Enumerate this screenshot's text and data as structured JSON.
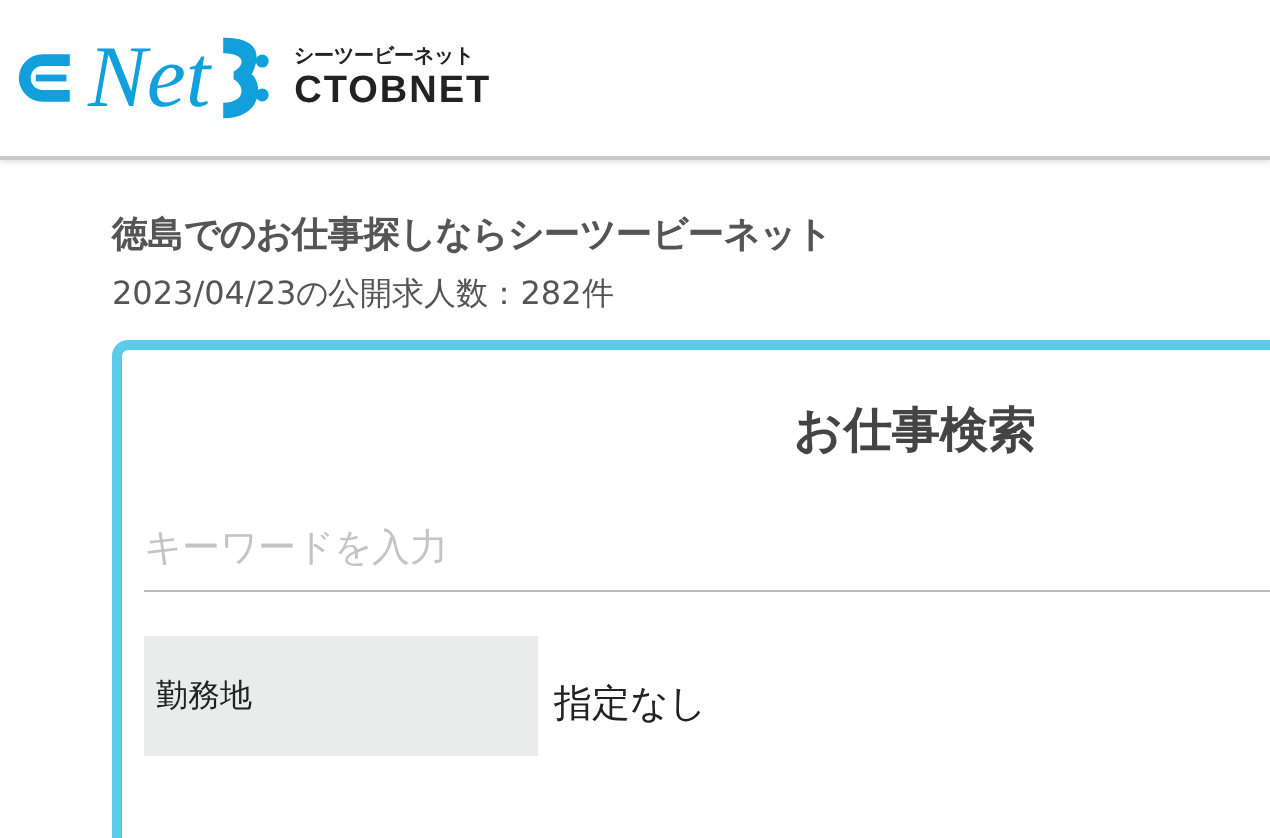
{
  "logo": {
    "wordmark": "Net",
    "kana": "シーツービーネット",
    "latin": "CTOBNET"
  },
  "intro": {
    "title": "徳島でのお仕事探しならシーツービーネット",
    "count": "2023/04/23の公開求人数：282件"
  },
  "search": {
    "title": "お仕事検索",
    "keyword": {
      "placeholder": "キーワードを入力"
    },
    "fields": [
      {
        "label": "勤務地",
        "value": "指定なし"
      }
    ]
  }
}
